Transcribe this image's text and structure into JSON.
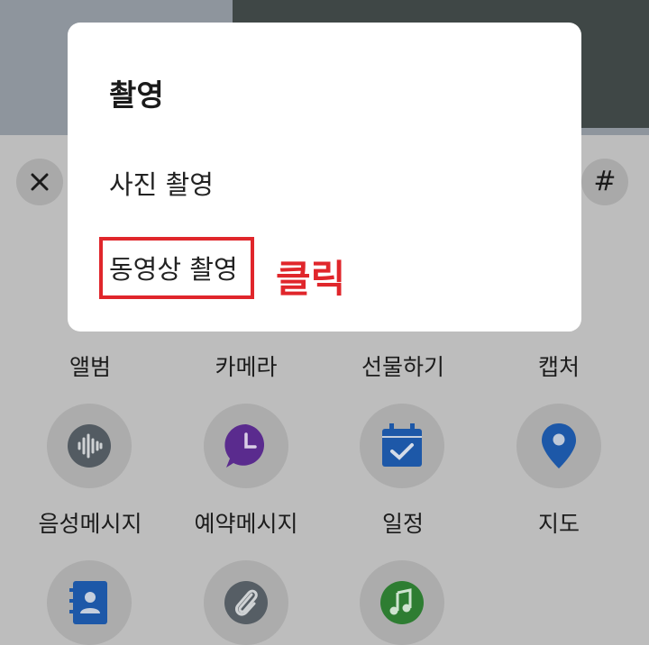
{
  "dialog": {
    "title": "촬영",
    "options": [
      "사진 촬영",
      "동영상 촬영"
    ]
  },
  "annotation": {
    "label": "클릭",
    "color": "#e0262b"
  },
  "panel": {
    "close_icon": "close-icon",
    "hash_label": "#",
    "items": [
      {
        "label": "앨범"
      },
      {
        "label": "카메라"
      },
      {
        "label": "선물하기"
      },
      {
        "label": "캡처"
      },
      {
        "label": "음성메시지",
        "icon": "voice-wave-icon"
      },
      {
        "label": "예약메시지",
        "icon": "clock-bubble-icon"
      },
      {
        "label": "일정",
        "icon": "calendar-check-icon"
      },
      {
        "label": "지도",
        "icon": "map-pin-icon"
      },
      {
        "icon": "contact-book-icon"
      },
      {
        "icon": "paperclip-icon"
      },
      {
        "icon": "music-note-icon"
      }
    ]
  }
}
